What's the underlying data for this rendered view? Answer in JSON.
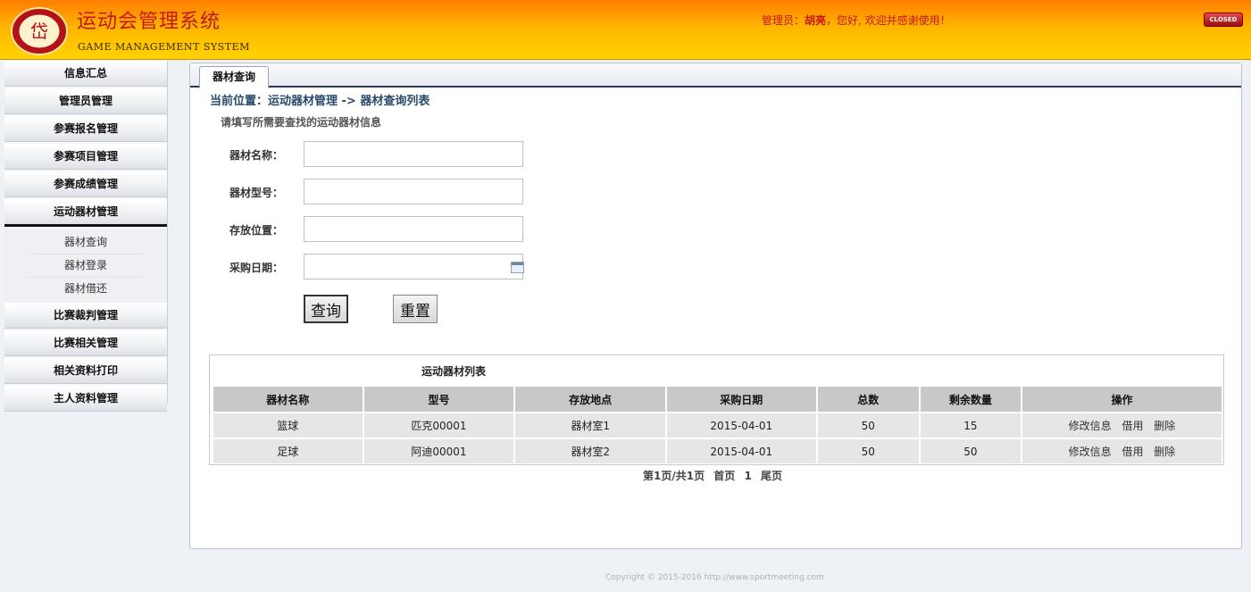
{
  "header": {
    "title": "运动会管理系统",
    "subtitle": "GAME MANAGEMENT SYSTEM",
    "welcome_prefix": "管理员：",
    "username": "胡亮",
    "welcome_suffix": "，您好, 欢迎并感谢使用！",
    "close_label": "CLOSED",
    "logo_text": "DATONG UNIVERSITY"
  },
  "sidebar": {
    "items": [
      {
        "label": "信息汇总"
      },
      {
        "label": "管理员管理"
      },
      {
        "label": "参赛报名管理"
      },
      {
        "label": "参赛项目管理"
      },
      {
        "label": "参赛成绩管理"
      },
      {
        "label": "运动器材管理"
      },
      {
        "label": "比赛裁判管理"
      },
      {
        "label": "比赛相关管理"
      },
      {
        "label": "相关资料打印"
      },
      {
        "label": "主人资料管理"
      }
    ],
    "subitems": [
      {
        "label": "器材查询"
      },
      {
        "label": "器材登录"
      },
      {
        "label": "器材借还"
      }
    ]
  },
  "main": {
    "tab_label": "器材查询",
    "breadcrumb": "当前位置：运动器材管理 -> 器材查询列表",
    "form_title": "请填写所需要查找的运动器材信息",
    "fields": {
      "name_label": "器材名称：",
      "model_label": "器材型号：",
      "location_label": "存放位置：",
      "date_label": "采购日期："
    },
    "query_label": "查询",
    "reset_label": "重置",
    "list_title": "运动器材列表",
    "columns": [
      "器材名称",
      "型号",
      "存放地点",
      "采购日期",
      "总数",
      "剩余数量",
      "操作"
    ],
    "rows": [
      {
        "name": "篮球",
        "model": "匹克00001",
        "location": "器材室1",
        "date": "2015-04-01",
        "total": "50",
        "remaining": "15"
      },
      {
        "name": "足球",
        "model": "阿迪00001",
        "location": "器材室2",
        "date": "2015-04-01",
        "total": "50",
        "remaining": "50"
      }
    ],
    "ops": {
      "edit": "修改信息",
      "borrow": "借用",
      "delete": "删除"
    },
    "pager": {
      "info": "第1页/共1页",
      "first": "首页",
      "page": "1",
      "last": "尾页"
    }
  },
  "footer": {
    "copyright": "Copyright © 2015-2016 http://www.sportmeeting.com"
  },
  "colors": {
    "header_top": "#ff7e00",
    "header_bottom": "#ffd200",
    "title_red": "#c4161c",
    "breadcrumb_blue": "#2a4a6b"
  }
}
